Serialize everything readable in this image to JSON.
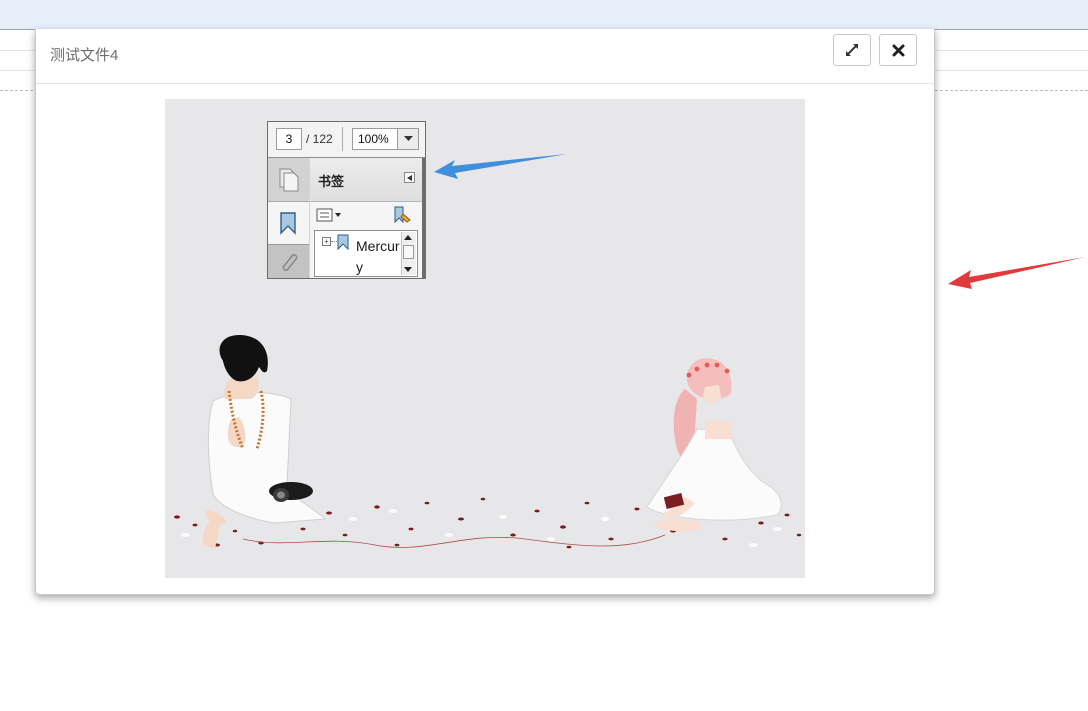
{
  "modal": {
    "title": "测试文件4",
    "buttons": {
      "expand": "expand-icon",
      "close": "close-icon"
    }
  },
  "pdf_panel": {
    "page_current": "3",
    "page_total": "/ 122",
    "zoom": "100%",
    "bookmarks_title": "书签",
    "bookmark_item": "Mercury",
    "icons": [
      "pages-icon",
      "bookmark-icon",
      "paperclip-icon",
      "options-icon",
      "new-bookmark-icon",
      "expand-plus-icon"
    ]
  },
  "colors": {
    "arrow_blue": "#3f8fde",
    "arrow_red": "#e23a3a",
    "topbar": "#e6eef9",
    "content_bg": "#e7e7e9"
  }
}
